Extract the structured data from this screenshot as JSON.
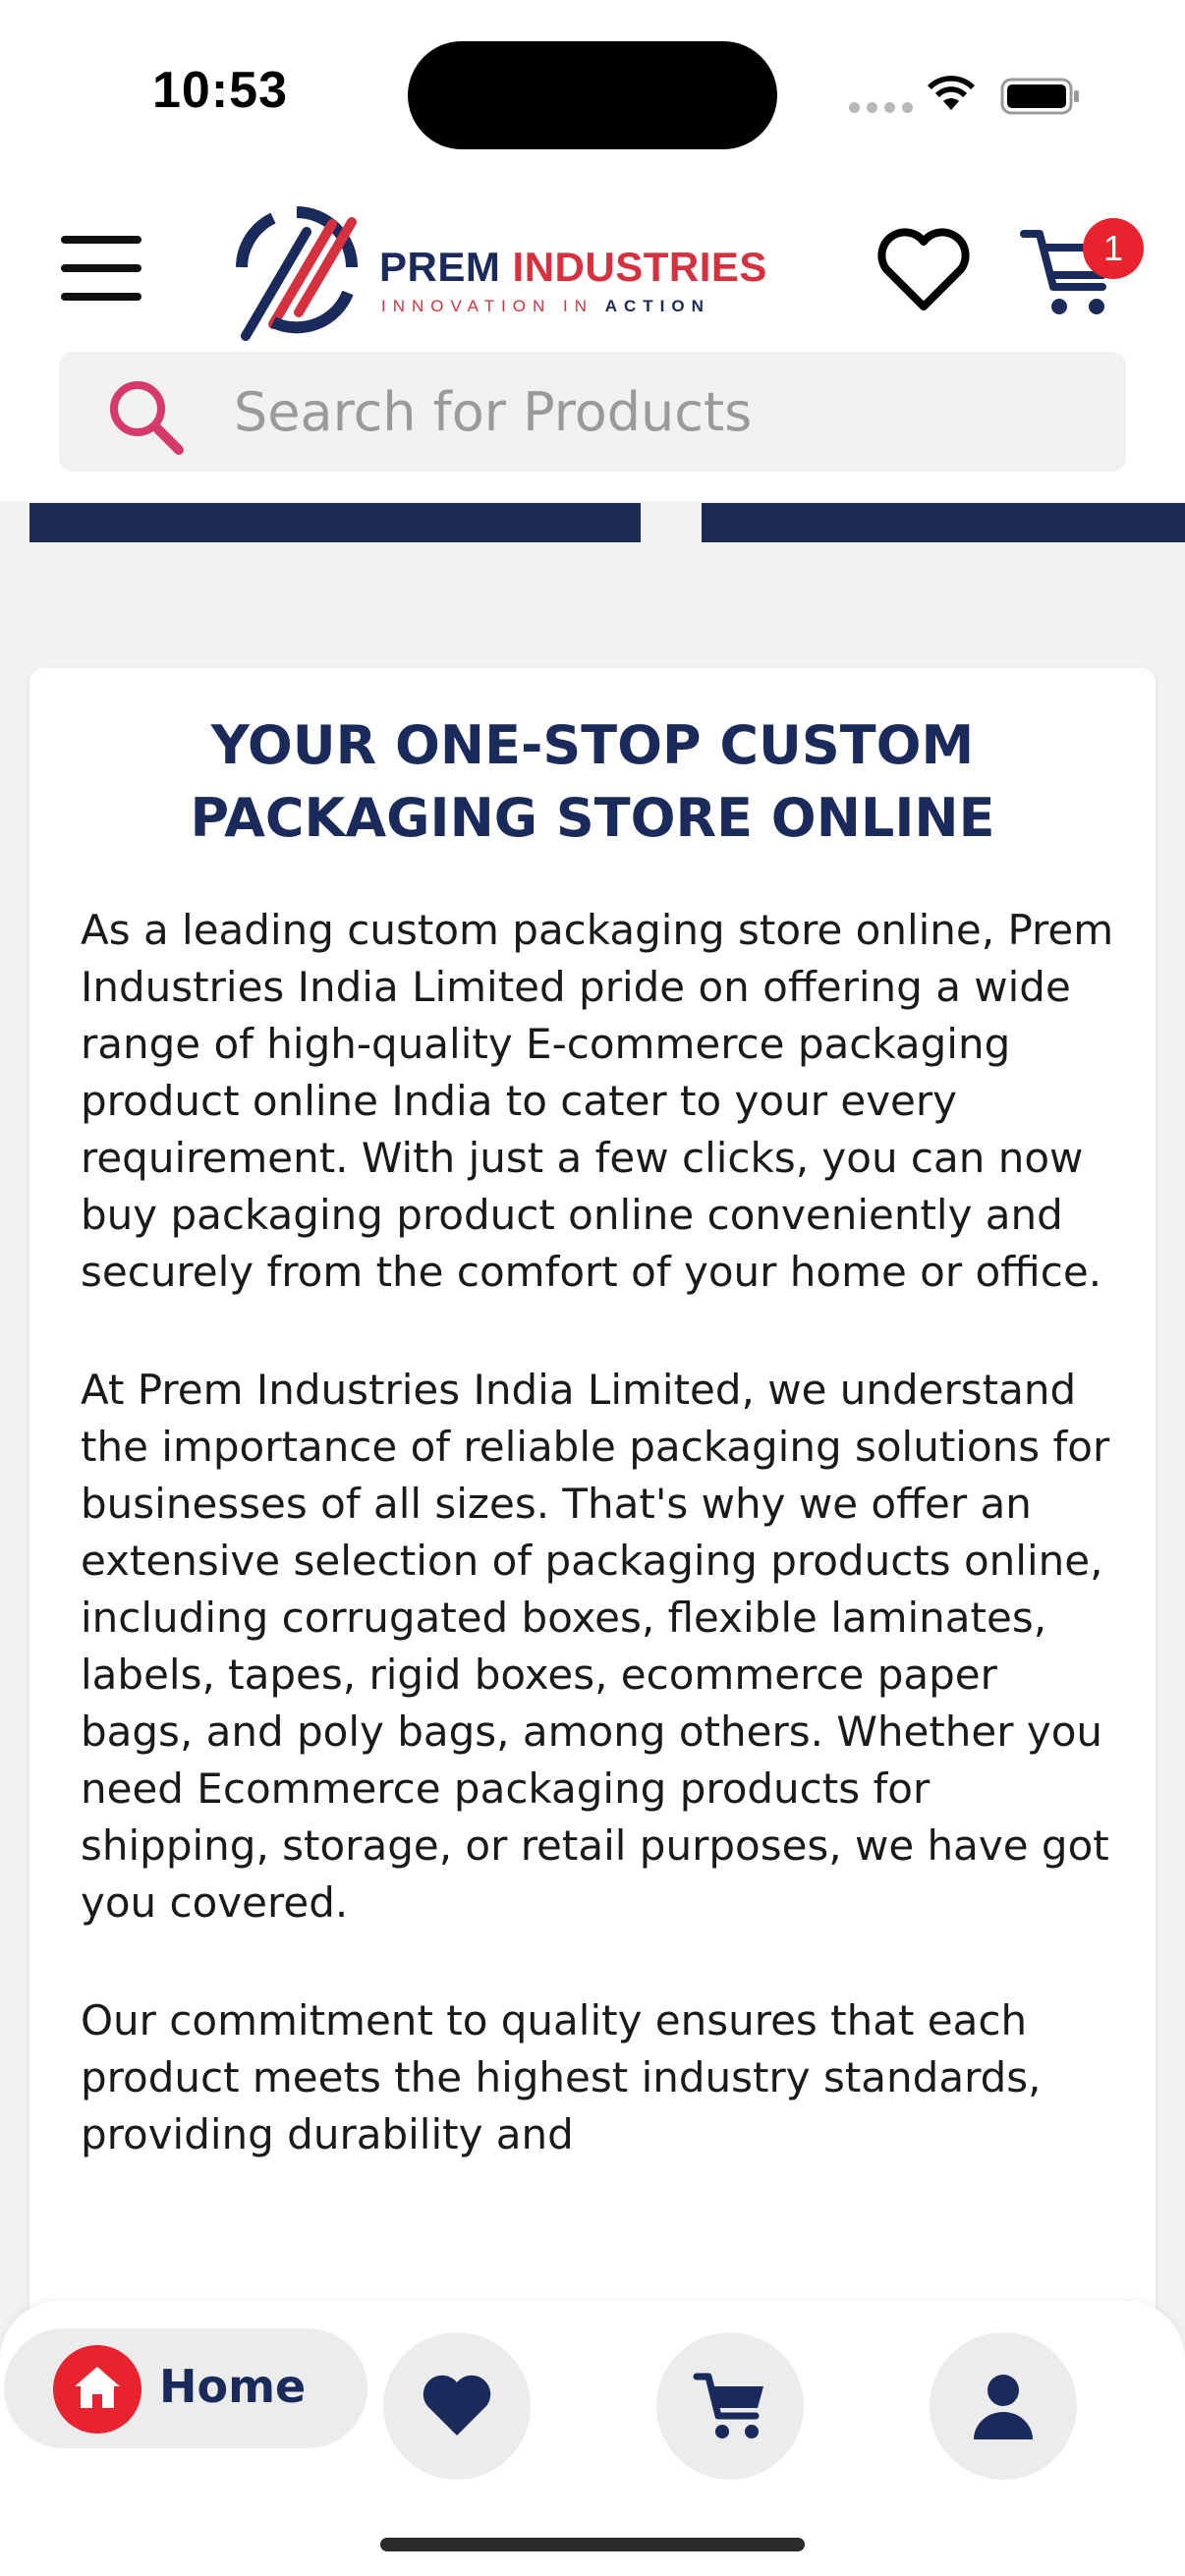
{
  "status_bar": {
    "time": "10:53"
  },
  "header": {
    "brand": {
      "title_part1": "PREM",
      "title_part2": "INDUSTRIES",
      "tagline_part1": "INNOVATION IN",
      "tagline_part2": "ACTION",
      "colors": {
        "navy": "#1a2a5a",
        "red": "#d6313e"
      }
    },
    "cart_count": "1",
    "icons": [
      "menu-icon",
      "heart-icon",
      "cart-icon",
      "search-icon"
    ]
  },
  "search": {
    "placeholder": "Search for Products",
    "value": ""
  },
  "content": {
    "title": "YOUR ONE-STOP CUSTOM PACKAGING STORE ONLINE",
    "paragraphs": [
      "As a leading custom packaging store online, Prem Industries India Limited pride on offering a wide range of high-quality E-commerce packaging product online India to cater to your every requirement. With just a few clicks, you can now buy packaging product online conveniently and securely from the comfort of your home or office.",
      "At Prem Industries India Limited, we understand the importance of reliable packaging solutions for businesses of all sizes. That's why we offer an extensive selection of packaging products online, including corrugated boxes, flexible laminates, labels, tapes, rigid boxes, ecommerce paper bags, and poly bags, among others. Whether you need Ecommerce packaging products for shipping, storage, or retail purposes, we have got you covered.",
      "Our commitment to quality ensures that each product meets the highest industry standards, providing durability and"
    ]
  },
  "bottom_nav": {
    "home_label": "Home",
    "items": [
      "home-icon",
      "heart-icon",
      "cart-icon",
      "user-icon"
    ],
    "accent": "#e8232e",
    "icon_color": "#1a2a5a"
  }
}
